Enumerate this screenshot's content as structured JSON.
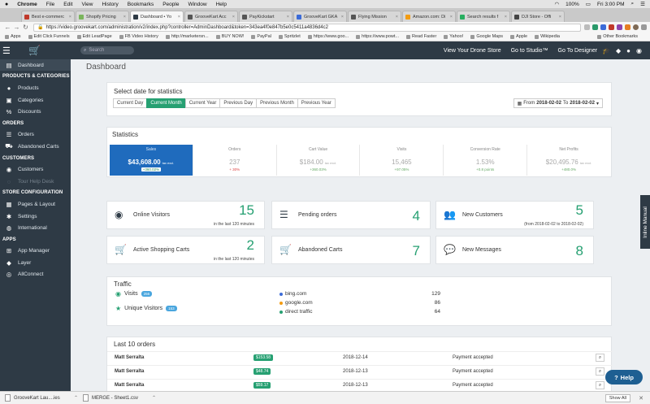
{
  "mac_menu": {
    "apple": "",
    "items": [
      "Chrome",
      "File",
      "Edit",
      "View",
      "History",
      "Bookmarks",
      "People",
      "Window",
      "Help"
    ],
    "battery": "100%",
    "clock": "Fri 3:00 PM"
  },
  "tabs": [
    {
      "title": "Best e-commerc",
      "color": "#c0392b"
    },
    {
      "title": "Shopify Pricing",
      "color": "#7ab55c"
    },
    {
      "title": "Dashboard • Yo",
      "color": "#2e3a45",
      "active": true
    },
    {
      "title": "GrooveKart Acc",
      "color": "#555555"
    },
    {
      "title": "PayKickstart",
      "color": "#555555"
    },
    {
      "title": "GrooveKart GKA",
      "color": "#3b6bd8"
    },
    {
      "title": "Flying Mission",
      "color": "#555555"
    },
    {
      "title": "Amazon.com: Di",
      "color": "#f39c12"
    },
    {
      "title": "Search results f",
      "color": "#27ae60"
    },
    {
      "title": "DJI Store - Offi",
      "color": "#444444"
    }
  ],
  "address": {
    "url": "https://video.groovekart.com/administration/v2/index.php?controller=AdminDashboard&token=343ea4f0e847b5e0c5411a4836d4c2"
  },
  "bookmarks": [
    "Apps",
    "Edit Click Funnels",
    "Edit LeadPage",
    "FB Video History",
    "http://marketersn...",
    "BUY NOW!",
    "PayPal",
    "Spritzlet",
    "https://www.goo...",
    "https://www.powt...",
    "Read Faster",
    "Yahoo!",
    "Google Maps",
    "Apple",
    "Wikipedia"
  ],
  "bookmarks_other": "Other Bookmarks",
  "header": {
    "search_placeholder": "Search",
    "links": [
      "View Your Drone Store",
      "Go to Studio™",
      "Go To Designer"
    ]
  },
  "sidebar": [
    {
      "type": "item",
      "label": "Dashboard",
      "icon": "dashboard-icon",
      "glyph": "▤",
      "active": true
    },
    {
      "type": "head",
      "label": "PRODUCTS & CATEGORIES"
    },
    {
      "type": "item",
      "label": "Products",
      "icon": "tag-icon",
      "glyph": "●"
    },
    {
      "type": "item",
      "label": "Categories",
      "icon": "folder-icon",
      "glyph": "▣"
    },
    {
      "type": "item",
      "label": "Discounts",
      "icon": "percent-icon",
      "glyph": "%"
    },
    {
      "type": "head",
      "label": "ORDERS"
    },
    {
      "type": "item",
      "label": "Orders",
      "icon": "list-icon",
      "glyph": "☰"
    },
    {
      "type": "item",
      "label": "Abandoned Carts",
      "icon": "cart-icon",
      "glyph": "⛟"
    },
    {
      "type": "head",
      "label": "CUSTOMERS"
    },
    {
      "type": "item",
      "label": "Customers",
      "icon": "user-icon",
      "glyph": "◉"
    },
    {
      "type": "item",
      "label": "Tour Help Desk",
      "icon": "help-desk-icon",
      "glyph": "◌",
      "dim": true
    },
    {
      "type": "head",
      "label": "STORE CONFIGURATION"
    },
    {
      "type": "item",
      "label": "Pages & Layout",
      "icon": "pages-icon",
      "glyph": "▦"
    },
    {
      "type": "item",
      "label": "Settings",
      "icon": "gear-icon",
      "glyph": "✱"
    },
    {
      "type": "item",
      "label": "International",
      "icon": "globe-icon",
      "glyph": "◍"
    },
    {
      "type": "head",
      "label": "APPS"
    },
    {
      "type": "item",
      "label": "App Manager",
      "icon": "apps-icon",
      "glyph": "⊞"
    },
    {
      "type": "item",
      "label": "Layer",
      "icon": "layers-icon",
      "glyph": "◆"
    },
    {
      "type": "item",
      "label": "AllConnect",
      "icon": "connect-icon",
      "glyph": "◎"
    }
  ],
  "page_title": "Dashboard",
  "date_select": {
    "title": "Select date for statistics",
    "buttons": [
      "Current Day",
      "Current Month",
      "Current Year",
      "Previous Day",
      "Previous Month",
      "Previous Year"
    ],
    "active_index": 1,
    "from_label": "From",
    "from": "2018-02-02",
    "to_label": "To",
    "to": "2018-02-02"
  },
  "statistics": {
    "title": "Statistics",
    "items": [
      {
        "label": "Sales",
        "value": "$43,608.00",
        "suffix": "tax excl.",
        "change": "+360.02%",
        "active": true
      },
      {
        "label": "Orders",
        "value": "237",
        "change": "+ 30%",
        "trend": "up"
      },
      {
        "label": "Cart Value",
        "value": "$184.00",
        "suffix": "tax excl.",
        "change": "+360.03%",
        "trend": "down"
      },
      {
        "label": "Visits",
        "value": "15,465",
        "change": "+97.05%",
        "trend": "up"
      },
      {
        "label": "Conversion Rate",
        "value": "1.53%",
        "change": "+0.8 points",
        "trend": "up"
      },
      {
        "label": "Net Profits",
        "value": "$20,495.76",
        "suffix": "tax excl.",
        "change": "+480.0%",
        "trend": "up"
      }
    ]
  },
  "tiles": [
    {
      "label": "Online Visitors",
      "value": "15",
      "sub": "in the last 120 minutes",
      "icon": "user-circle-icon",
      "glyph": "◉"
    },
    {
      "label": "Pending orders",
      "value": "4",
      "sub": "",
      "icon": "list-icon",
      "glyph": "☰"
    },
    {
      "label": "New Customers",
      "value": "5",
      "sub": "(from 2018-02-02 to 2018-02-02)",
      "icon": "users-icon",
      "glyph": "👥"
    },
    {
      "label": "Active Shopping Carts",
      "value": "2",
      "sub": "in the last 120 minutes",
      "icon": "cart-icon",
      "glyph": "🛒"
    },
    {
      "label": "Abandoned Carts",
      "value": "7",
      "sub": "",
      "icon": "cart-plus-icon",
      "glyph": "🛒"
    },
    {
      "label": "New Messages",
      "value": "8",
      "sub": "",
      "icon": "chat-icon",
      "glyph": "💬"
    }
  ],
  "traffic": {
    "title": "Traffic",
    "visits_label": "Visits",
    "visits_badge": "256",
    "unique_label": "Unique Visitors",
    "unique_badge": "153",
    "sources": [
      {
        "name": "bing.com",
        "count": "129",
        "color": "#3b6bd8"
      },
      {
        "name": "google.com",
        "count": "86",
        "color": "#f39c12"
      },
      {
        "name": "direct traffic",
        "count": "64",
        "color": "#26a072"
      }
    ]
  },
  "orders": {
    "title": "Last 10 orders",
    "rows": [
      {
        "customer": "Matt Serralta",
        "amount": "$153.58",
        "date": "2018-12-14",
        "status": "Payment accepted"
      },
      {
        "customer": "Matt Serralta",
        "amount": "$48.74",
        "date": "2018-12-13",
        "status": "Payment accepted"
      },
      {
        "customer": "Matt Serralta",
        "amount": "$59.17",
        "date": "2018-12-13",
        "status": "Payment accepted"
      }
    ]
  },
  "inline_manual": "Inline Manual",
  "help_button": "Help",
  "downloads": {
    "items": [
      "GrooveKart Lau....ies",
      "MERGE - Sheet1.csv"
    ],
    "show_all": "Show All"
  },
  "colors": {
    "sidebar": "#2e3a45",
    "accent_green": "#26a072",
    "sales_blue": "#1f6bbd"
  }
}
